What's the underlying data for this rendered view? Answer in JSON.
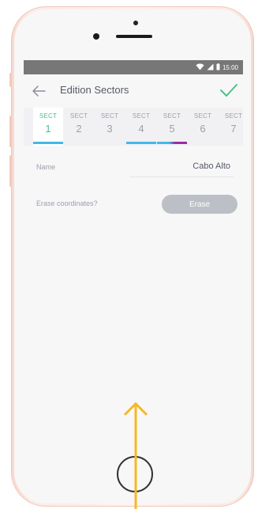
{
  "status_bar": {
    "time": "15:00",
    "icons": [
      "wifi-icon",
      "signal-icon",
      "battery-icon"
    ]
  },
  "app_bar": {
    "title": "Edition Sectors",
    "back_icon": "arrow-left-icon",
    "confirm_icon": "check-icon"
  },
  "tabs": [
    {
      "prefix": "SECT",
      "number": "1",
      "active": true,
      "bar_color": "#42b8e8"
    },
    {
      "prefix": "SECT",
      "number": "2",
      "active": false,
      "bar_color": ""
    },
    {
      "prefix": "SECT",
      "number": "3",
      "active": false,
      "bar_color": ""
    },
    {
      "prefix": "SECT",
      "number": "4",
      "active": false,
      "bar_color": "#42b8e8"
    },
    {
      "prefix": "SECT",
      "number": "5",
      "active": false,
      "bar_color": "#42b8e8|#9b2ca8"
    },
    {
      "prefix": "SECT",
      "number": "6",
      "active": false,
      "bar_color": ""
    },
    {
      "prefix": "SECT",
      "number": "7",
      "active": false,
      "bar_color": ""
    }
  ],
  "form": {
    "name_label": "Name",
    "name_value": "Cabo Alto",
    "erase_label": "Erase coordinates?",
    "erase_button": "Erase"
  },
  "colors": {
    "accent_green": "#4cc089",
    "tab_blue": "#42b8e8",
    "tab_purple": "#9b2ca8",
    "status_bar": "#777777"
  }
}
